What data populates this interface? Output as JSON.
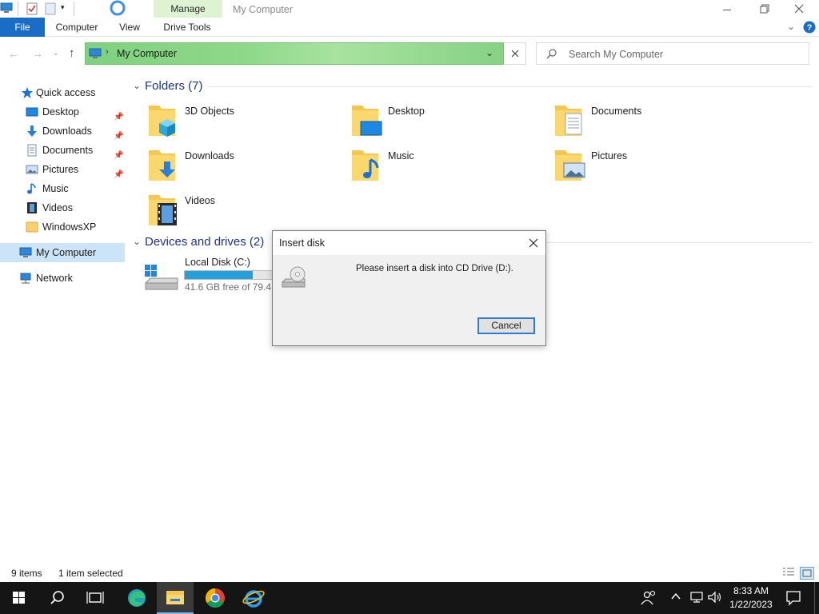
{
  "window": {
    "title": "My Computer",
    "contextual_tab_group": "Manage",
    "controls": {
      "minimize": "minimize",
      "restore": "restore",
      "close": "close"
    }
  },
  "ribbon": {
    "tabs": [
      {
        "label": "File",
        "active": true
      },
      {
        "label": "Computer"
      },
      {
        "label": "View"
      },
      {
        "label": "Drive Tools"
      }
    ]
  },
  "address": {
    "path": "My Computer",
    "search_placeholder": "Search My Computer"
  },
  "nav": {
    "quick_access": "Quick access",
    "items": [
      {
        "label": "Desktop",
        "icon": "desktop-icon",
        "pinned": true
      },
      {
        "label": "Downloads",
        "icon": "downloads-icon",
        "pinned": true
      },
      {
        "label": "Documents",
        "icon": "documents-icon",
        "pinned": true
      },
      {
        "label": "Pictures",
        "icon": "pictures-icon",
        "pinned": true
      },
      {
        "label": "Music",
        "icon": "music-icon",
        "pinned": false
      },
      {
        "label": "Videos",
        "icon": "videos-icon",
        "pinned": false
      },
      {
        "label": "WindowsXP",
        "icon": "folder-icon",
        "pinned": false
      }
    ],
    "my_computer": "My Computer",
    "network": "Network"
  },
  "content": {
    "folders_header": "Folders (7)",
    "folders": [
      {
        "label": "3D Objects",
        "icon": "3d-objects-icon"
      },
      {
        "label": "Desktop",
        "icon": "desktop-icon"
      },
      {
        "label": "Documents",
        "icon": "documents-icon"
      },
      {
        "label": "Downloads",
        "icon": "downloads-icon"
      },
      {
        "label": "Music",
        "icon": "music-icon"
      },
      {
        "label": "Pictures",
        "icon": "pictures-icon"
      },
      {
        "label": "Videos",
        "icon": "videos-icon"
      }
    ],
    "devices_header": "Devices and drives (2)",
    "drive": {
      "label": "Local Disk (C:)",
      "free_text": "41.6 GB free of 79.4 GB",
      "used_fraction": 0.476
    }
  },
  "status": {
    "items": "9 items",
    "selected": "1 item selected"
  },
  "dialog": {
    "title": "Insert disk",
    "message": "Please insert a disk into CD Drive (D:).",
    "cancel": "Cancel"
  },
  "taskbar": {
    "time": "8:33 AM",
    "date": "1/22/2023"
  },
  "colors": {
    "file_tab": "#1a6dc6",
    "manage_tab": "#ddf3d2",
    "address_highlight": "#86d184",
    "taskbar": "#151515",
    "drive_bar": "#26a0da"
  }
}
